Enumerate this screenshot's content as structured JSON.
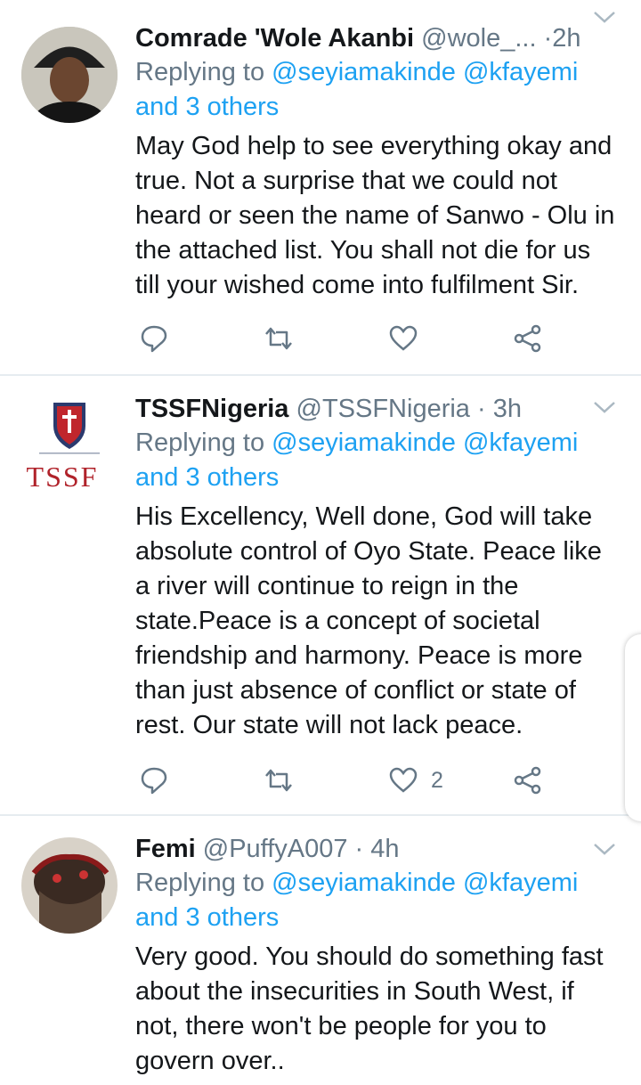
{
  "tweets": [
    {
      "name": "Comrade 'Wole Akanbi",
      "handle": "@wole_...",
      "time": "2h",
      "replying_prefix": "Replying to",
      "mention1": "@seyiamakinde",
      "mention2": "@kfayemi",
      "and_others": "and 3 others",
      "lines": [
        "May God help to see everything okay and",
        "true. Not a surprise that we could not",
        "heard or seen the name of Sanwo - Olu in",
        "the attached list. You shall not die for us",
        "till your wished come into fulfilment Sir."
      ],
      "like_count": ""
    },
    {
      "name": "TSSFNigeria",
      "handle": "@TSSFNigeria",
      "time": "3h",
      "replying_prefix": "Replying to",
      "mention1": "@seyiamakinde",
      "mention2": "@kfayemi",
      "and_others": "and 3 others",
      "avatar_text": "TSSF",
      "lines": [
        "His Excellency, Well done, God will take",
        "absolute control of Oyo State. Peace like",
        "a river will continue to reign in the",
        "state.Peace is a concept of societal",
        "friendship and harmony. Peace is more",
        "than just absence of conflict or state of",
        "rest. Our state will not lack peace."
      ],
      "like_count": "2"
    },
    {
      "name": "Femi",
      "handle": "@PuffyA007",
      "time": "4h",
      "replying_prefix": "Replying to",
      "mention1": "@seyiamakinde",
      "mention2": "@kfayemi",
      "and_others": "and 3 others",
      "lines": [
        "Very good. You should do something fast",
        "about the insecurities in South West, if",
        "not, there won't be people for you to",
        "govern over.."
      ],
      "like_count": ""
    }
  ],
  "colors": {
    "link": "#1da1f2",
    "meta": "#657786",
    "text": "#14171a",
    "divider": "#e6ecf0"
  }
}
